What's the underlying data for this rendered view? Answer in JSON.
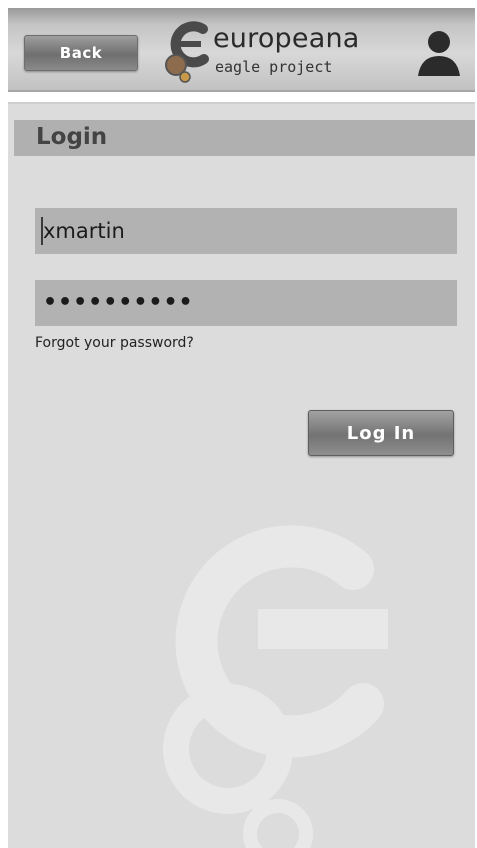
{
  "header": {
    "back_label": "Back",
    "brand_name": "europeana",
    "brand_sub": "eagle project"
  },
  "login": {
    "title": "Login",
    "username_value": "xmartin",
    "password_value": "••••••••••",
    "forgot_label": "Forgot your password?",
    "login_button_label": "Log In"
  },
  "icons": {
    "user": "user-icon",
    "brand": "europeana-logo-icon",
    "background": "europeana-watermark-icon"
  }
}
